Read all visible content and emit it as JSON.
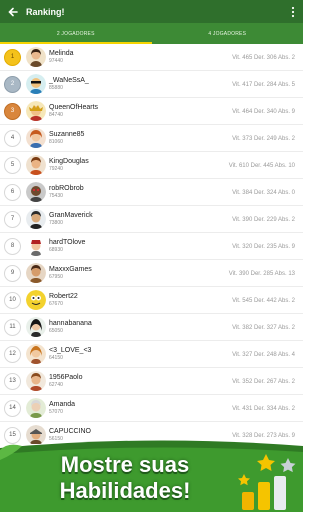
{
  "appbar": {
    "title": "Ranking!"
  },
  "tabs": [
    {
      "label": "2 JOGADORES",
      "active": true
    },
    {
      "label": "4 JOGADORES",
      "active": false
    }
  ],
  "players": [
    {
      "rank": "1",
      "name": "Melinda",
      "points": "97440",
      "stats": "Vit. 465  Der. 306  Abs. 2"
    },
    {
      "rank": "2",
      "name": "_WaNeSsA_",
      "points": "85880",
      "stats": "Vit. 417  Der. 284  Abs. 5"
    },
    {
      "rank": "3",
      "name": "QueenOfHearts",
      "points": "84740",
      "stats": "Vit. 464  Der. 340  Abs. 9"
    },
    {
      "rank": "4",
      "name": "Suzanne85",
      "points": "81060",
      "stats": "Vit. 373  Der. 249  Abs. 2"
    },
    {
      "rank": "5",
      "name": "KingDouglas",
      "points": "79240",
      "stats": "Vit. 610  Der. 445  Abs. 10"
    },
    {
      "rank": "6",
      "name": "robRObrob",
      "points": "75430",
      "stats": "Vit. 384  Der. 324  Abs. 0"
    },
    {
      "rank": "7",
      "name": "GranMaverick",
      "points": "73800",
      "stats": "Vit. 390  Der. 229  Abs. 2"
    },
    {
      "rank": "8",
      "name": "hardTOlove",
      "points": "68930",
      "stats": "Vit. 320  Der. 235  Abs. 9"
    },
    {
      "rank": "9",
      "name": "MaxxxGames",
      "points": "67950",
      "stats": "Vit. 390  Der. 285  Abs. 13"
    },
    {
      "rank": "10",
      "name": "Robert22",
      "points": "67670",
      "stats": "Vit. 545  Der. 442  Abs. 2"
    },
    {
      "rank": "11",
      "name": "hannabanana",
      "points": "65050",
      "stats": "Vit. 382  Der. 327  Abs. 2"
    },
    {
      "rank": "12",
      "name": "<3_LOVE_<3",
      "points": "64150",
      "stats": "Vit. 327  Der. 248  Abs. 4"
    },
    {
      "rank": "13",
      "name": "1956Paolo",
      "points": "62740",
      "stats": "Vit. 352  Der. 267  Abs. 2"
    },
    {
      "rank": "14",
      "name": "Amanda",
      "points": "57070",
      "stats": "Vit. 431  Der. 334  Abs. 2"
    },
    {
      "rank": "15",
      "name": "CAPUCCINO",
      "points": "56150",
      "stats": "Vit. 328  Der. 273  Abs. 9"
    }
  ],
  "banner": {
    "line1": "Mostre suas",
    "line2": "Habilidades!"
  },
  "colors": {
    "appbar": "#2f6f2c",
    "tabs": "#3d8a35",
    "indicator": "#f5d400",
    "gold": "#f4c21b",
    "silver": "#a9b8c5",
    "bronze": "#d9863c"
  }
}
